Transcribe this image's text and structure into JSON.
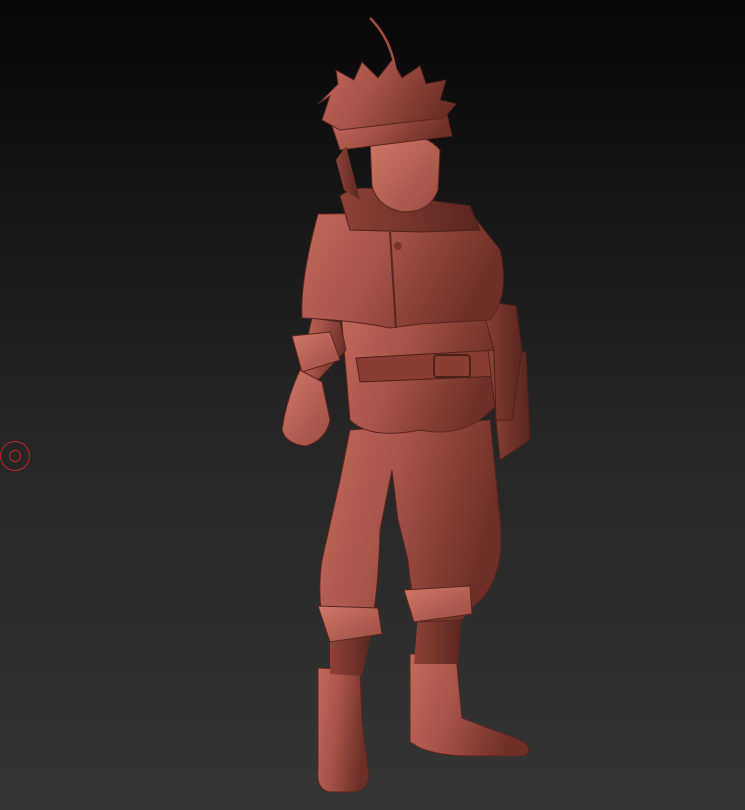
{
  "viewport": {
    "background_top": "#060606",
    "background_bottom": "#353535",
    "material_color": "#a14d42",
    "brush_cursor_color": "#c0282a",
    "model_subject": "sculpted-character-figure"
  }
}
